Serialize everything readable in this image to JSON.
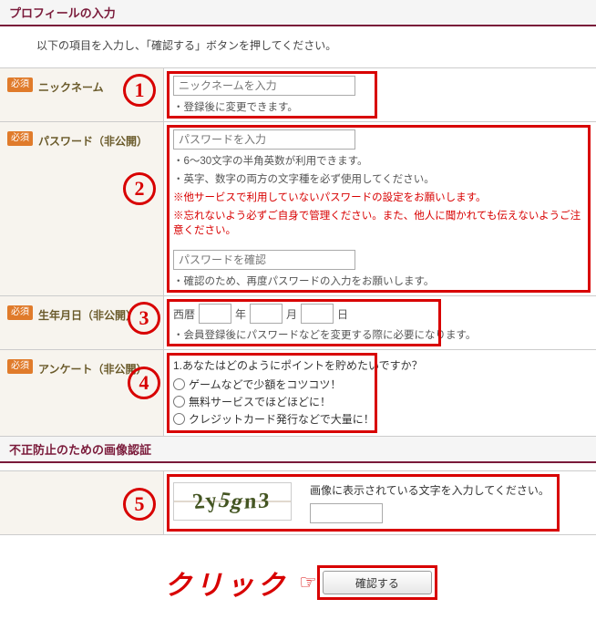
{
  "header": {
    "profile": "プロフィールの入力",
    "captcha": "不正防止のための画像認証",
    "instruction": "以下の項目を入力し、「確認する」ボタンを押してください。"
  },
  "badge": "必須",
  "markers": {
    "one": "1",
    "two": "2",
    "three": "3",
    "four": "4",
    "five": "5"
  },
  "fields": {
    "nickname": {
      "label": "ニックネーム",
      "placeholder": "ニックネームを入力",
      "note1": "登録後に変更できます。"
    },
    "password": {
      "label": "パスワード（非公開）",
      "placeholder1": "パスワードを入力",
      "note1": "6～30文字の半角英数が利用できます。",
      "note2": "英字、数字の両方の文字種を必ず使用してください。",
      "warn1": "※他サービスで利用していないパスワードの設定をお願いします。",
      "warn2": "※忘れないよう必ずご自身で管理ください。また、他人に聞かれても伝えないようご注意ください。",
      "placeholder2": "パスワードを確認",
      "note3": "確認のため、再度パスワードの入力をお願いします。"
    },
    "dob": {
      "label": "生年月日（非公開）",
      "era": "西暦",
      "year": "年",
      "month": "月",
      "day": "日",
      "note": "会員登録後にパスワードなどを変更する際に必要になります。"
    },
    "survey": {
      "label": "アンケート（非公開）",
      "question": "1.あなたはどのようにポイントを貯めたいですか？",
      "opt1": "ゲームなどで少額をコツコツ！",
      "opt2": "無料サービスでほどほどに！",
      "opt3": "クレジットカード発行などで大量に！"
    }
  },
  "captcha": {
    "image_text": "2y5gn3",
    "instruction": "画像に表示されている文字を入力してください。"
  },
  "button": {
    "click_label": "クリック",
    "submit": "確認する"
  }
}
